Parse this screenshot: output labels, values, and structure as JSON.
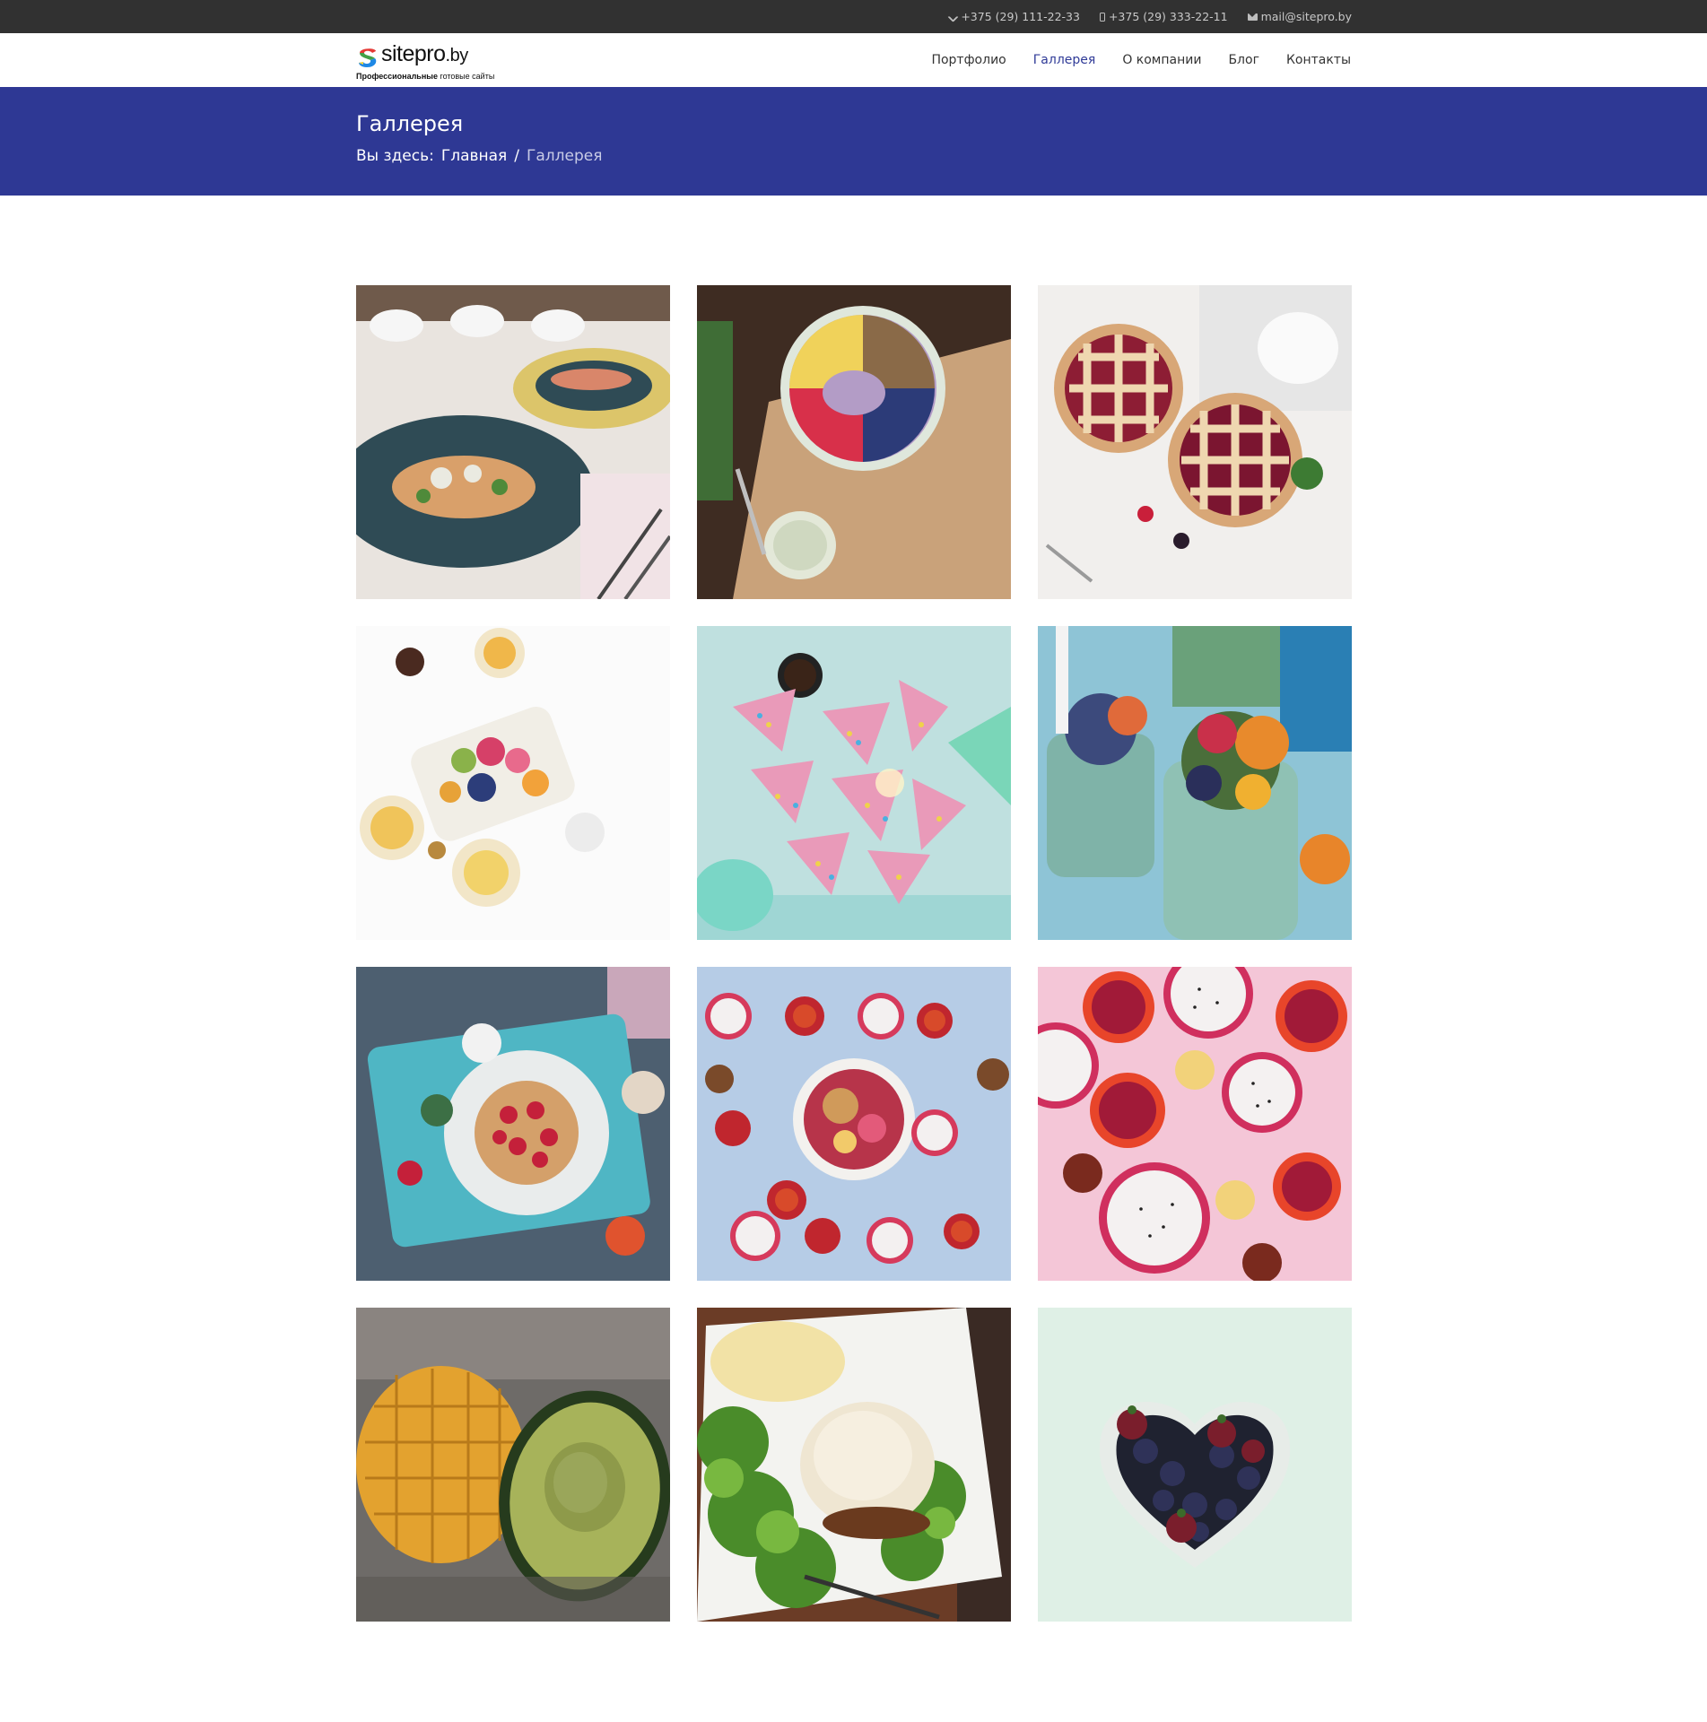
{
  "topbar": {
    "phone1": "+375 (29) 111-22-33",
    "phone2": "+375 (29) 333-22-11",
    "email": "mail@sitepro.by"
  },
  "header": {
    "logo": {
      "site": "sitepro",
      "domain": ".by",
      "tagline_bold": "Профессиональные",
      "tagline_rest": "готовые сайты"
    },
    "nav": [
      {
        "label": "Портфолио",
        "active": false
      },
      {
        "label": "Галлерея",
        "active": true
      },
      {
        "label": "О компании",
        "active": false
      },
      {
        "label": "Блог",
        "active": false
      },
      {
        "label": "Контакты",
        "active": false
      }
    ]
  },
  "banner": {
    "title": "Галлерея",
    "breadcrumb_prefix": "Вы здесь:",
    "breadcrumb_home": "Главная",
    "breadcrumb_separator": "/",
    "breadcrumb_current": "Галлерея"
  },
  "gallery": {
    "images": [
      {
        "name": "salad-plates-photo",
        "bg": "#e9e4df",
        "accent": "#2f4b55"
      },
      {
        "name": "smoothie-bowl-photo",
        "bg": "#4a3428",
        "accent": "#c9a27a"
      },
      {
        "name": "berry-pies-photo",
        "bg": "#f1efed",
        "accent": "#8d1d34"
      },
      {
        "name": "fruit-platter-photo",
        "bg": "#fbfbfb",
        "accent": "#e7a238"
      },
      {
        "name": "sprinkle-cake-photo",
        "bg": "#bfe0df",
        "accent": "#e99ab9"
      },
      {
        "name": "fruit-parfait-photo",
        "bg": "#8ec4d6",
        "accent": "#e88a2c"
      },
      {
        "name": "pancake-tray-photo",
        "bg": "#4d5f70",
        "accent": "#4fb6c4"
      },
      {
        "name": "dragonfruit-bowl-photo",
        "bg": "#b6cce6",
        "accent": "#d63a5c"
      },
      {
        "name": "citrus-dragonfruit-photo",
        "bg": "#f4c6d7",
        "accent": "#d02f5e"
      },
      {
        "name": "mango-avocado-photo",
        "bg": "#6e6b68",
        "accent": "#e3a22f"
      },
      {
        "name": "burger-salad-photo",
        "bg": "#6b3c26",
        "accent": "#4a8c2a"
      },
      {
        "name": "heart-berries-photo",
        "bg": "#dff0e6",
        "accent": "#7a1e2c"
      }
    ]
  }
}
